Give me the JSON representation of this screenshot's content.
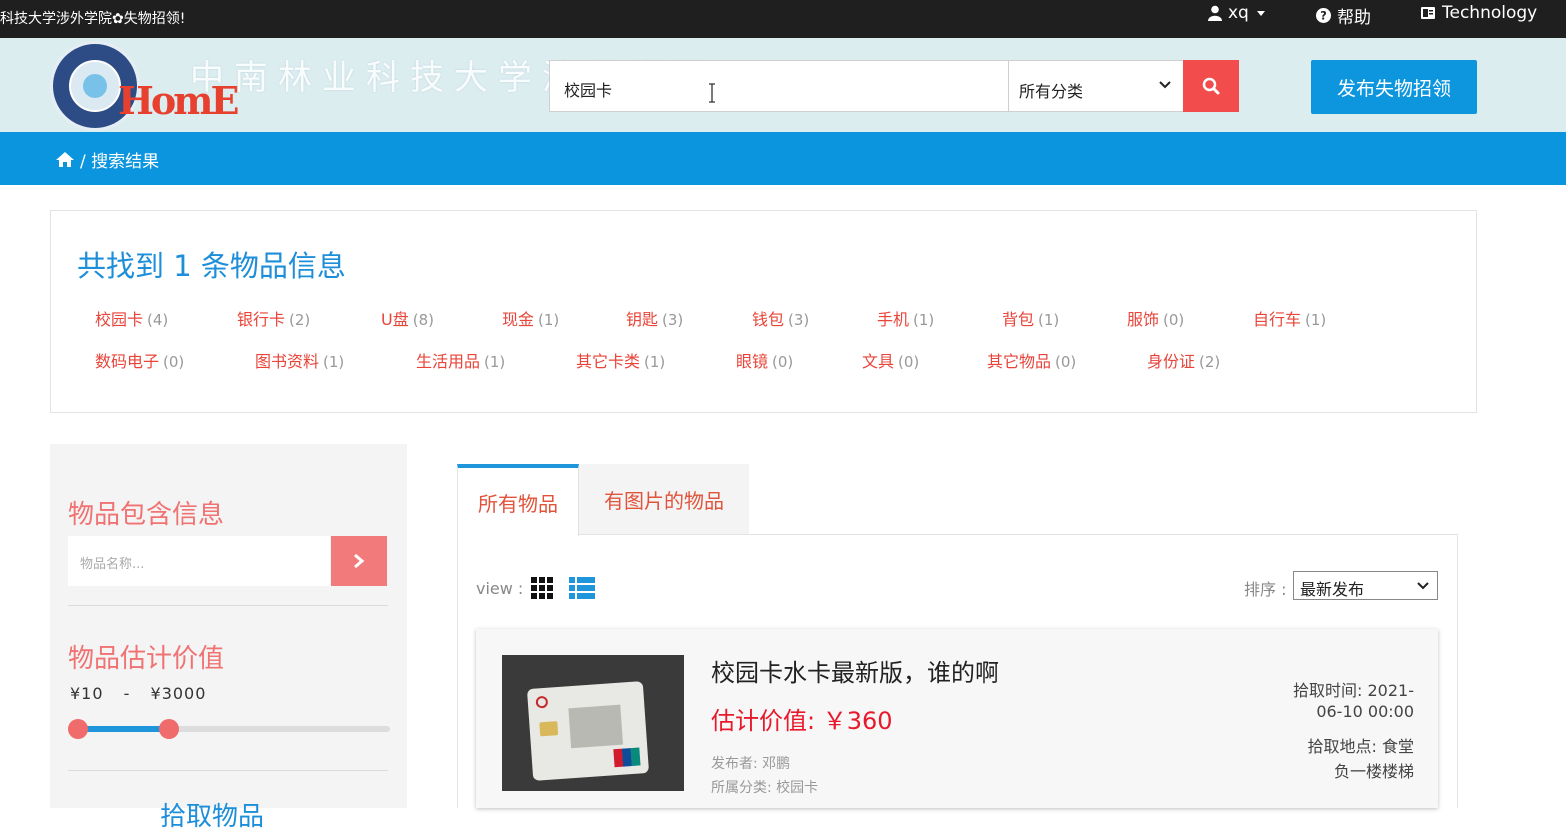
{
  "topbar": {
    "site_title": "科技大学涉外学院✿失物招领!",
    "user": "xq",
    "help": "帮助",
    "language": "Technology"
  },
  "header": {
    "logo_text": "HomE",
    "banner_text": "中南林业科技大学涉外学院",
    "search_value": "校园卡",
    "category_selected": "所有分类",
    "publish_label": "发布失物招领"
  },
  "breadcrumb": {
    "text": "/ 搜索结果"
  },
  "summary": {
    "title": "共找到 1 条物品信息",
    "categories": [
      {
        "label": "校园卡",
        "count": "(4)"
      },
      {
        "label": "银行卡",
        "count": "(2)"
      },
      {
        "label": "U盘",
        "count": "(8)"
      },
      {
        "label": "现金",
        "count": "(1)"
      },
      {
        "label": "钥匙",
        "count": "(3)"
      },
      {
        "label": "钱包",
        "count": "(3)"
      },
      {
        "label": "手机",
        "count": "(1)"
      },
      {
        "label": "背包",
        "count": "(1)"
      },
      {
        "label": "服饰",
        "count": "(0)"
      },
      {
        "label": "自行车",
        "count": "(1)"
      },
      {
        "label": "数码电子",
        "count": "(0)"
      },
      {
        "label": "图书资料",
        "count": "(1)"
      },
      {
        "label": "生活用品",
        "count": "(1)"
      },
      {
        "label": "其它卡类",
        "count": "(1)"
      },
      {
        "label": "眼镜",
        "count": "(0)"
      },
      {
        "label": "文具",
        "count": "(0)"
      },
      {
        "label": "其它物品",
        "count": "(0)"
      },
      {
        "label": "身份证",
        "count": "(2)"
      }
    ]
  },
  "sidebar": {
    "info_heading": "物品包含信息",
    "name_placeholder": "物品名称...",
    "value_heading": "物品估计价值",
    "price_min": "¥10",
    "price_sep": "-",
    "price_max": "¥3000",
    "price_low_fraction": 0.0,
    "price_high_fraction": 0.3,
    "next_heading": "拾取物品"
  },
  "tabs": {
    "all": "所有物品",
    "with_images": "有图片的物品"
  },
  "toolbar": {
    "view_label": "view :",
    "sort_label": "排序 :",
    "sort_selected": "最新发布"
  },
  "item": {
    "title": "校园卡水卡最新版，谁的啊",
    "value": "估计价值: ￥360",
    "publisher": "发布者: 邓鹏",
    "category": "所属分类: 校园卡",
    "time_line1": "拾取时间: 2021-",
    "time_line2": "06-10 00:00",
    "place_line1": "拾取地点: 食堂",
    "place_line2": "负一楼楼梯"
  },
  "colors": {
    "accent_blue": "#0b95df",
    "search_red": "#f24c4c",
    "category_red": "#e8443a",
    "value_red": "#e8192c",
    "sidebar_heading": "#f07272"
  }
}
